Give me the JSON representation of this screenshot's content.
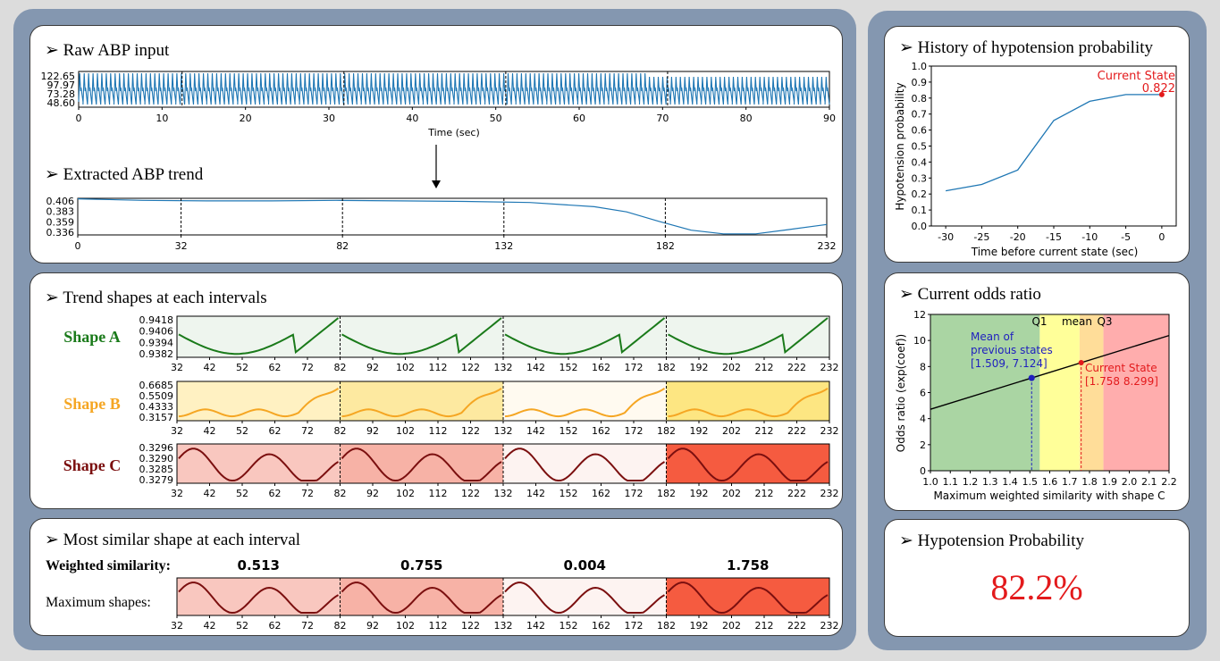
{
  "colors": {
    "accent": "#e31a1c",
    "line": "#1f77b4",
    "shapeA": "#1a7a1a",
    "shapeB": "#f5a623",
    "shapeC": "#7b0f0f"
  },
  "raw": {
    "title": "Raw ABP input",
    "ytick": [
      "122.65",
      "97.97",
      "73.28",
      "48.60"
    ],
    "xtick": [
      "0",
      "10",
      "20",
      "30",
      "40",
      "50",
      "60",
      "70",
      "80",
      "90"
    ],
    "xlabel": "Time (sec)",
    "chart_data": {
      "type": "line",
      "x_range": [
        0,
        90
      ],
      "ylim": [
        48.6,
        122.65
      ],
      "dividers": [
        12.4,
        31.8,
        51.2,
        70.6
      ],
      "description_values": {
        "beats_approx": 170
      }
    }
  },
  "trend": {
    "title": "Extracted ABP trend",
    "ytick": [
      "0.406",
      "0.383",
      "0.359",
      "0.336"
    ],
    "xtick": [
      "0",
      "32",
      "82",
      "132",
      "182",
      "232"
    ],
    "chart_data": {
      "type": "line",
      "x": [
        0,
        20,
        40,
        60,
        80,
        100,
        120,
        140,
        160,
        170,
        180,
        190,
        200,
        210,
        220,
        232
      ],
      "y": [
        0.405,
        0.402,
        0.401,
        0.401,
        0.402,
        0.401,
        0.4,
        0.398,
        0.39,
        0.38,
        0.362,
        0.345,
        0.338,
        0.338,
        0.346,
        0.356
      ],
      "xlim": [
        0,
        232
      ],
      "ylim": [
        0.336,
        0.406
      ],
      "dividers": [
        32,
        82,
        132,
        182
      ]
    }
  },
  "shapes": {
    "title": "Trend shapes at each intervals",
    "xtick": [
      "32",
      "42",
      "52",
      "62",
      "72",
      "82",
      "92",
      "102",
      "112",
      "122",
      "132",
      "142",
      "152",
      "162",
      "172",
      "182",
      "192",
      "202",
      "212",
      "222",
      "232"
    ],
    "A": {
      "name": "Shape A",
      "ytick": [
        "0.9418",
        "0.9406",
        "0.9394",
        "0.9382"
      ],
      "bg": [
        "#eef5ee",
        "#eef5ee",
        "#eef5ee",
        "#eef5ee"
      ]
    },
    "B": {
      "name": "Shape B",
      "ytick": [
        "0.6685",
        "0.5509",
        "0.4333",
        "0.3157"
      ],
      "bg": [
        "#fff1c2",
        "#fde9a0",
        "#fffaf0",
        "#fde682"
      ]
    },
    "C": {
      "name": "Shape C",
      "ytick": [
        "0.3296",
        "0.3290",
        "0.3285",
        "0.3279"
      ],
      "bg": [
        "#f9c7bf",
        "#f7b2a6",
        "#fdf3f1",
        "#f55b40"
      ]
    }
  },
  "similar": {
    "title": "Most similar shape at each interval",
    "weighted_label": "Weighted similarity:",
    "weights": [
      "0.513",
      "0.755",
      "0.004",
      "1.758"
    ],
    "maximum_label": "Maximum shapes:",
    "bg": [
      "#f9c7bf",
      "#f7b2a6",
      "#fdf3f1",
      "#f55b40"
    ]
  },
  "history": {
    "title": "History of hypotension probability",
    "ylabel": "Hypotension probability",
    "xlabel": "Time before current state (sec)",
    "current_label": "Current State",
    "current_value": "0.822",
    "xtick": [
      "-30",
      "-25",
      "-20",
      "-15",
      "-10",
      "-5",
      "0"
    ],
    "ytick": [
      "1.0",
      "0.9",
      "0.8",
      "0.7",
      "0.6",
      "0.5",
      "0.4",
      "0.3",
      "0.2",
      "0.1",
      "0.0"
    ],
    "chart_data": {
      "type": "line",
      "x": [
        -30,
        -25,
        -20,
        -15,
        -10,
        -5,
        0
      ],
      "y": [
        0.22,
        0.26,
        0.35,
        0.66,
        0.78,
        0.822,
        0.822
      ],
      "xlim": [
        -32,
        2
      ],
      "ylim": [
        0,
        1
      ]
    }
  },
  "odds": {
    "title": "Current odds ratio",
    "ylabel": "Odds ratio (exp(coef))",
    "xlabel": "Maximum weighted similarity with shape C",
    "xtick": [
      "1.0",
      "1.1",
      "1.2",
      "1.3",
      "1.4",
      "1.5",
      "1.6",
      "1.7",
      "1.8",
      "1.9",
      "2.0",
      "2.1",
      "2.2"
    ],
    "ytick": [
      "12",
      "10",
      "8",
      "6",
      "4",
      "2",
      "0"
    ],
    "q1": "Q1",
    "mean": "mean",
    "q3": "Q3",
    "mean_label": [
      "Mean of",
      "previous states",
      "[1.509, 7.124]"
    ],
    "current_label": [
      "Current State",
      "[1.758 8.299]"
    ],
    "chart_data": {
      "type": "line",
      "xlim": [
        1.0,
        2.2
      ],
      "ylim": [
        0,
        12
      ],
      "line": [
        [
          1.0,
          4.72
        ],
        [
          2.2,
          10.38
        ]
      ],
      "zones": [
        [
          1.0,
          1.55,
          "#aad5a3"
        ],
        [
          1.55,
          1.75,
          "#ffff99"
        ],
        [
          1.75,
          1.87,
          "#ffdd99"
        ],
        [
          1.87,
          2.2,
          "#ffadad"
        ]
      ],
      "mean_point": [
        1.509,
        7.124
      ],
      "current_point": [
        1.758,
        8.299
      ]
    }
  },
  "prob": {
    "title": "Hypotension Probability",
    "value": "82.2%"
  }
}
